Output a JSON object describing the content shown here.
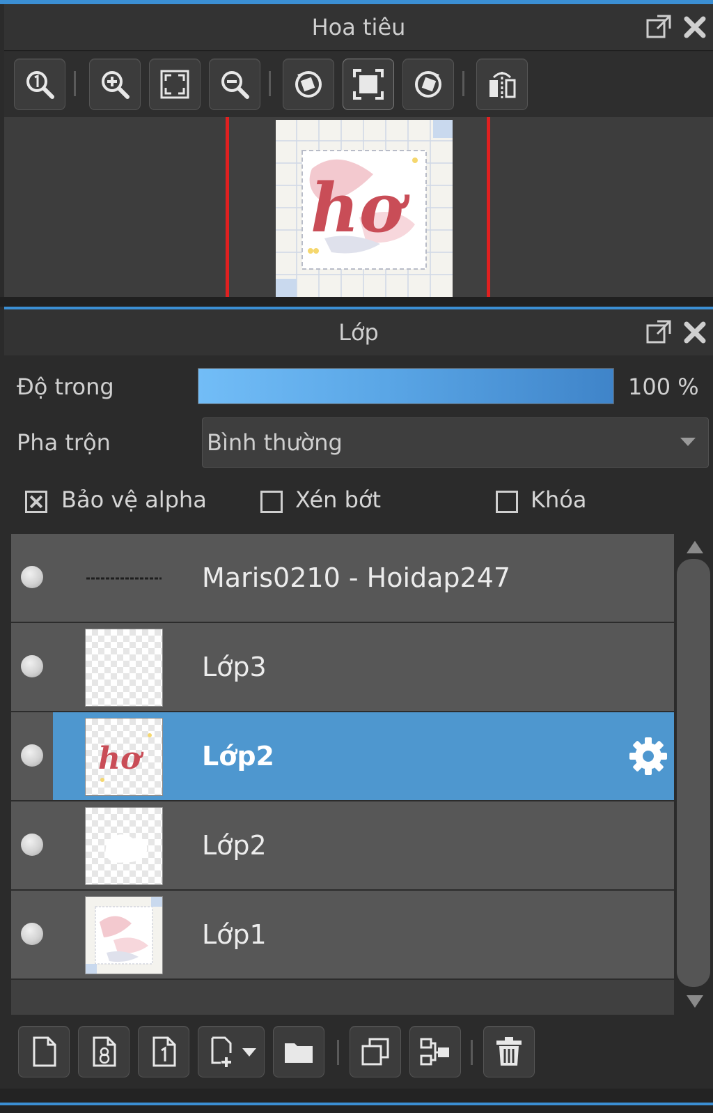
{
  "navigator": {
    "title": "Hoa tiêu",
    "toolbar": [
      {
        "name": "actual-size-icon"
      },
      {
        "name": "zoom-in-icon"
      },
      {
        "name": "fit-window-icon"
      },
      {
        "name": "zoom-out-icon"
      },
      {
        "name": "rotate-left-icon"
      },
      {
        "name": "reset-view-icon"
      },
      {
        "name": "rotate-right-icon"
      },
      {
        "name": "flip-horizontal-icon"
      }
    ],
    "preview": {
      "watermark": "Maris0210 - Hoidap247",
      "artwork_text": "hơ"
    }
  },
  "layers_panel": {
    "title": "Lớp",
    "opacity_label": "Độ trong",
    "opacity_value": "100 %",
    "opacity_fraction": 1.0,
    "blend_label": "Pha trộn",
    "blend_value": "Bình thường",
    "checkboxes": [
      {
        "label": "Bảo vệ alpha",
        "checked": true
      },
      {
        "label": "Xén bớt",
        "checked": false
      },
      {
        "label": "Khóa",
        "checked": false
      }
    ],
    "layers": [
      {
        "name": "Maris0210 - Hoidap247",
        "selected": false,
        "thumb": "text"
      },
      {
        "name": "Lớp3",
        "selected": false,
        "thumb": "empty"
      },
      {
        "name": "Lớp2",
        "selected": true,
        "thumb": "lettering"
      },
      {
        "name": "Lớp2",
        "selected": false,
        "thumb": "white-shape"
      },
      {
        "name": "Lớp1",
        "selected": false,
        "thumb": "background"
      }
    ],
    "toolbar": [
      {
        "name": "new-layer-icon"
      },
      {
        "name": "new-8bit-layer-icon"
      },
      {
        "name": "new-1bit-layer-icon"
      },
      {
        "name": "add-layer-menu-icon"
      },
      {
        "name": "new-folder-icon"
      },
      {
        "name": "duplicate-layer-icon"
      },
      {
        "name": "merge-down-icon"
      },
      {
        "name": "delete-layer-icon"
      }
    ]
  },
  "colors": {
    "accent": "#3b8fd4",
    "selected_row": "#4e97cf",
    "panel_bg": "#2b2b2b",
    "row_bg": "#575757"
  }
}
